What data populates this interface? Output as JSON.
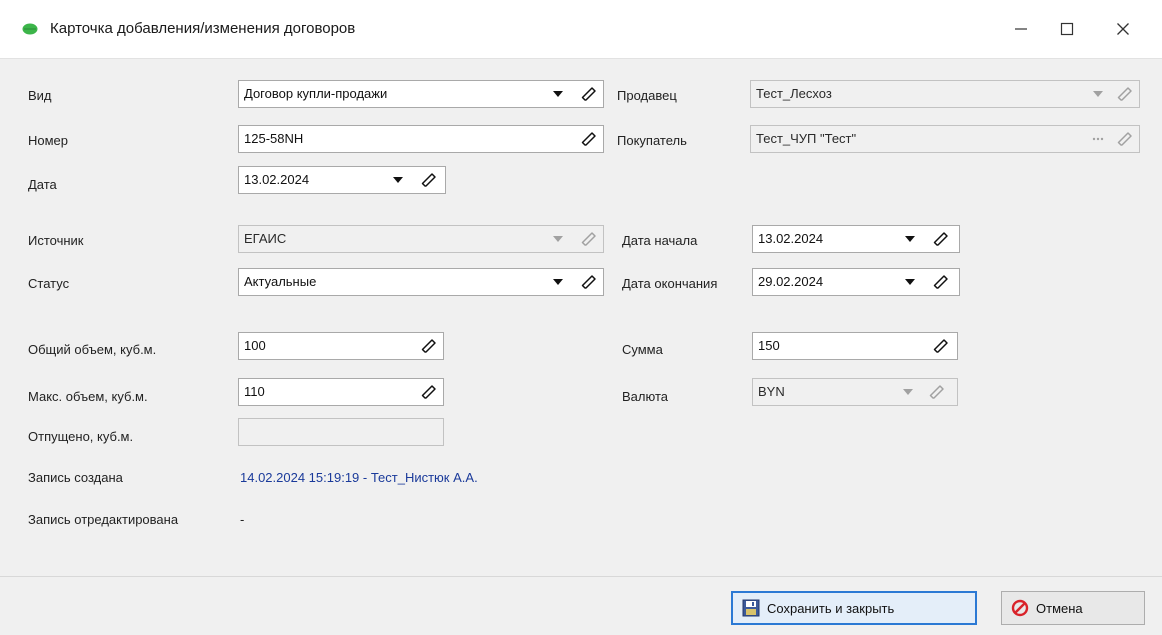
{
  "window": {
    "title": "Карточка добавления/изменения договоров"
  },
  "form": {
    "vid": {
      "label": "Вид",
      "value": "Договор купли-продажи"
    },
    "nomer": {
      "label": "Номер",
      "value": "125-58NH"
    },
    "data": {
      "label": "Дата",
      "value": "13.02.2024"
    },
    "prodavec": {
      "label": "Продавец",
      "value": "Тест_Лесхоз"
    },
    "pokupatel": {
      "label": "Покупатель",
      "value": "Тест_ЧУП \"Тест\""
    },
    "istochnik": {
      "label": "Источник",
      "value": "ЕГАИС"
    },
    "status": {
      "label": "Статус",
      "value": "Актуальные"
    },
    "data_nachala": {
      "label": "Дата начала",
      "value": "13.02.2024"
    },
    "data_okonchaniya": {
      "label": "Дата окончания",
      "value": "29.02.2024"
    },
    "obshiy_obem": {
      "label": "Общий объем, куб.м.",
      "value": "100"
    },
    "maks_obem": {
      "label": "Макс. объем, куб.м.",
      "value": "110"
    },
    "otpusheno": {
      "label": "Отпущено, куб.м.",
      "value": ""
    },
    "summa": {
      "label": "Сумма",
      "value": "150"
    },
    "valyuta": {
      "label": "Валюта",
      "value": "BYN"
    },
    "zapis_sozdana": {
      "label": "Запись создана",
      "value": "14.02.2024 15:19:19 - Тест_Нистюк А.А."
    },
    "zapis_otredaktirovana": {
      "label": "Запись отредактирована",
      "value": "-"
    }
  },
  "buttons": {
    "save_close": "Сохранить и закрыть",
    "cancel": "Отмена"
  },
  "icons": {
    "app": "leaf-icon",
    "minimize": "minimize-icon",
    "maximize": "maximize-icon",
    "close": "close-icon",
    "dropdown": "chevron-down-icon",
    "clear": "eraser-icon",
    "ellipsis": "ellipsis-icon",
    "save": "save-icon",
    "cancel": "cancel-icon"
  },
  "colors": {
    "accent": "#2b79d4",
    "link": "#1a3a9a",
    "app_icon": "#3cb54a",
    "cancel_icon": "#d9232a"
  }
}
